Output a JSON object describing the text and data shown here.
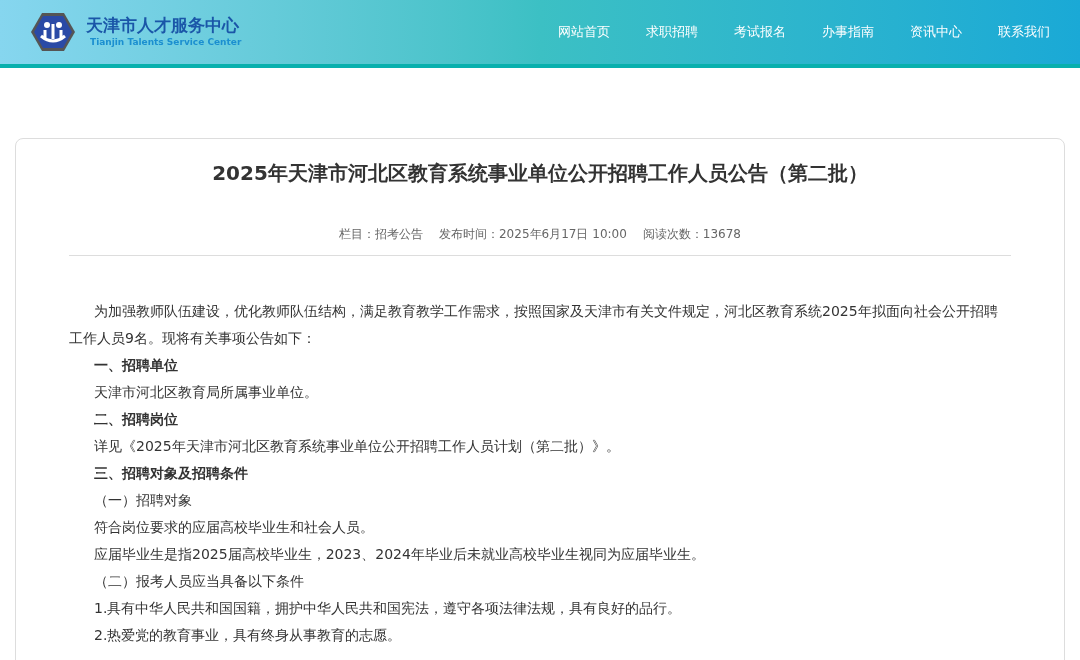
{
  "header": {
    "logo_title": "天津市人才服务中心",
    "logo_subtitle": "Tianjin Talents Service Center",
    "nav": [
      {
        "label": "网站首页"
      },
      {
        "label": "求职招聘"
      },
      {
        "label": "考试报名"
      },
      {
        "label": "办事指南"
      },
      {
        "label": "资讯中心"
      },
      {
        "label": "联系我们"
      }
    ]
  },
  "article": {
    "title": "2025年天津市河北区教育系统事业单位公开招聘工作人员公告（第二批）",
    "meta": [
      "栏目：招考公告",
      "发布时间：2025年6月17日 10:00",
      "阅读次数：13678"
    ],
    "paragraphs": [
      {
        "kind": "text",
        "text": "为加强教师队伍建设，优化教师队伍结构，满足教育教学工作需求，按照国家及天津市有关文件规定，河北区教育系统2025年拟面向社会公开招聘工作人员9名。现将有关事项公告如下："
      },
      {
        "kind": "heading",
        "text": "一、招聘单位"
      },
      {
        "kind": "text",
        "text": "天津市河北区教育局所属事业单位。"
      },
      {
        "kind": "heading",
        "text": "二、招聘岗位"
      },
      {
        "kind": "text",
        "text": "详见《2025年天津市河北区教育系统事业单位公开招聘工作人员计划（第二批）》。"
      },
      {
        "kind": "heading",
        "text": "三、招聘对象及招聘条件"
      },
      {
        "kind": "text",
        "text": "（一）招聘对象"
      },
      {
        "kind": "text",
        "text": "符合岗位要求的应届高校毕业生和社会人员。"
      },
      {
        "kind": "text",
        "text": "应届毕业生是指2025届高校毕业生，2023、2024年毕业后未就业高校毕业生视同为应届毕业生。"
      },
      {
        "kind": "text",
        "text": "（二）报考人员应当具备以下条件"
      },
      {
        "kind": "text",
        "text": "1.具有中华人民共和国国籍，拥护中华人民共和国宪法，遵守各项法律法规，具有良好的品行。"
      },
      {
        "kind": "text",
        "text": "2.热爱党的教育事业，具有终身从事教育的志愿。"
      }
    ]
  }
}
